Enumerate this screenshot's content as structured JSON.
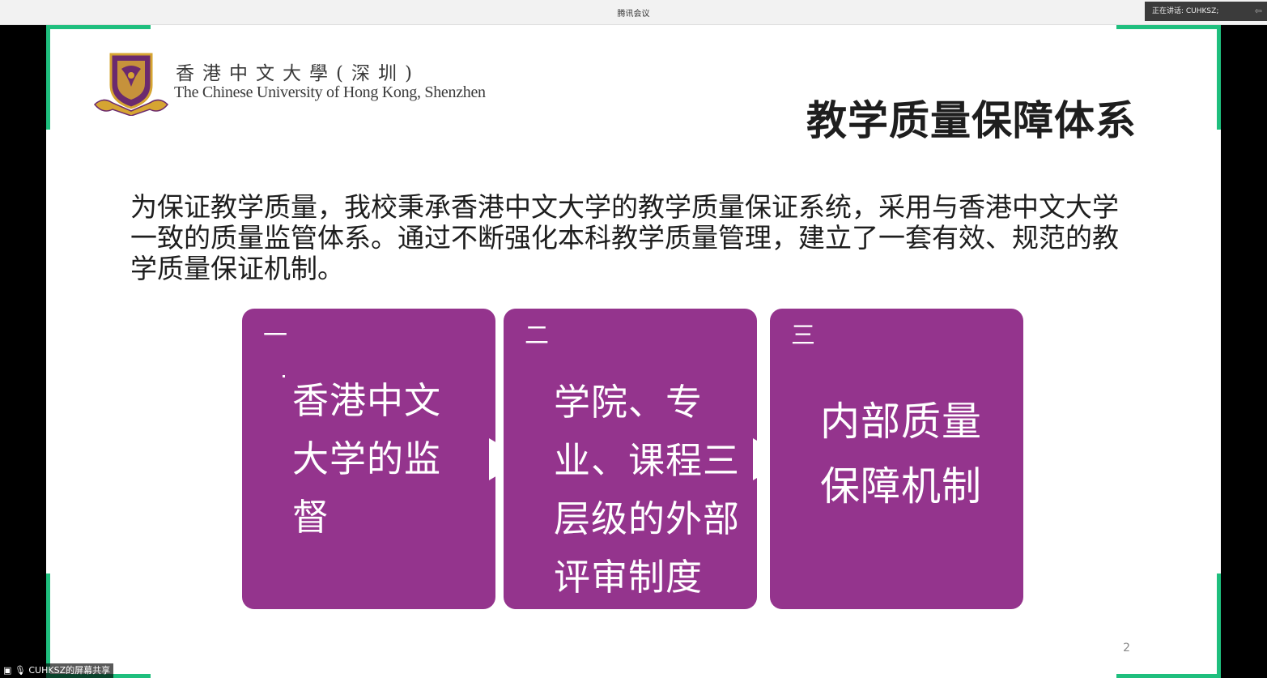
{
  "window": {
    "title": "腾讯会议",
    "speaking_label": "正在讲话: CUHKSZ;",
    "share_label": "CUHKSZ的屏幕共享"
  },
  "slide": {
    "logo": {
      "chinese": "香港中文大學(深圳)",
      "english": "The Chinese University of Hong Kong, Shenzhen"
    },
    "title": "教学质量保障体系",
    "body": "为保证教学质量，我校秉承香港中文大学的教学质量保证系统，采用与香港中文大学一致的质量监管体系。通过不断强化本科教学质量管理，建立了一套有效、规范的教学质量保证机制。",
    "steps": [
      {
        "number": "一",
        "text": "香港中文大学的监督"
      },
      {
        "number": "二",
        "text": "学院、专业、课程三层级的外部评审制度"
      },
      {
        "number": "三",
        "text": "内部质量保障机制"
      }
    ],
    "page_number": "2"
  },
  "colors": {
    "accent_green": "#1fbf7e",
    "box_purple": "#94348d",
    "logo_purple": "#6b2a6e",
    "logo_gold": "#d6a532"
  }
}
